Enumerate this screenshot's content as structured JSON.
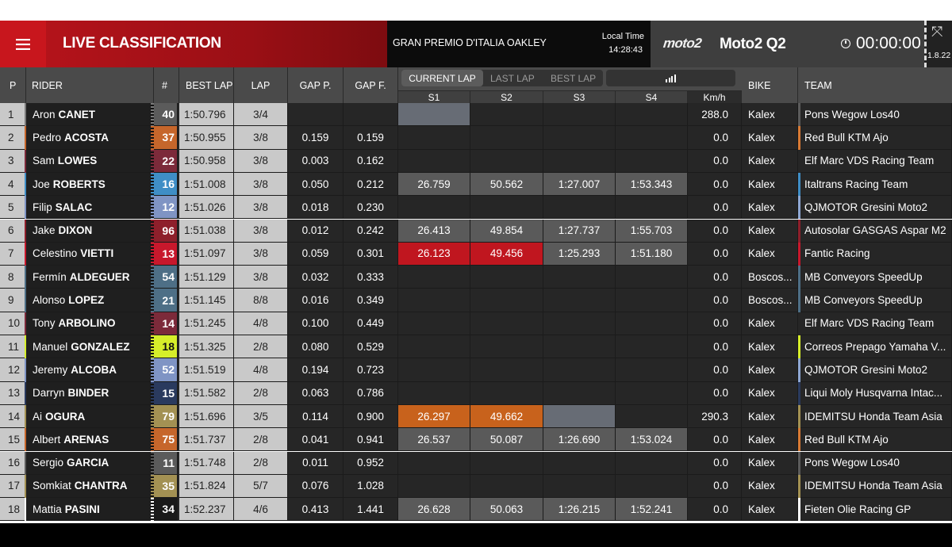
{
  "header": {
    "title": "LIVE CLASSIFICATION",
    "event": "GRAN PREMIO D'ITALIA OAKLEY",
    "local_time_label": "Local Time",
    "local_time": "14:28:43",
    "brand_logo": "moto2",
    "session": "Moto2 Q2",
    "timer": "00:00:00",
    "version": "1.8.22"
  },
  "columns": {
    "pos": "P",
    "rider": "RIDER",
    "num": "#",
    "best_lap": "BEST LAP",
    "lap": "LAP",
    "gap_p": "GAP P.",
    "gap_f": "GAP F.",
    "bike": "BIKE",
    "team": "TEAM",
    "s1": "S1",
    "s2": "S2",
    "s3": "S3",
    "s4": "S4",
    "kmh": "Km/h"
  },
  "tabs": [
    "CURRENT LAP",
    "LAST LAP",
    "BEST LAP"
  ],
  "icons": {
    "menu": "hamburger-menu-icon",
    "clock": "clock-icon",
    "expand": "expand-icon",
    "signal": "signal-bars-icon"
  },
  "colors": {
    "accent": "#c8161d"
  },
  "rows": [
    {
      "pos": "1",
      "first": "Aron",
      "last": "CANET",
      "num": "40",
      "num_bg": "#5b5b5b",
      "strip": "#7a7a7a",
      "best": "1:50.796",
      "lap": "3/4",
      "gap_p": "",
      "gap_f": "",
      "s1": "",
      "s2": "",
      "s3": "",
      "s4": "",
      "s1_bg": "#676c75",
      "kmh": "288.0",
      "bike": "Kalex",
      "team": "Pons Wegow Los40",
      "team_color": "#5b5b5b"
    },
    {
      "pos": "2",
      "first": "Pedro",
      "last": "ACOSTA",
      "num": "37",
      "num_bg": "#c6662b",
      "strip": "#c6662b",
      "best": "1:50.955",
      "lap": "3/8",
      "gap_p": "0.159",
      "gap_f": "0.159",
      "s1": "",
      "s2": "",
      "s3": "",
      "s4": "",
      "kmh": "0.0",
      "bike": "Kalex",
      "team": "Red Bull KTM Ajo",
      "team_color": "#d87a34"
    },
    {
      "pos": "3",
      "first": "Sam",
      "last": "LOWES",
      "num": "22",
      "num_bg": "#7c2a3a",
      "strip": "#7c2a3a",
      "best": "1:50.958",
      "lap": "3/8",
      "gap_p": "0.003",
      "gap_f": "0.162",
      "s1": "",
      "s2": "",
      "s3": "",
      "s4": "",
      "kmh": "0.0",
      "bike": "Kalex",
      "team": "Elf Marc VDS Racing Team",
      "team_color": "#262626"
    },
    {
      "pos": "4",
      "first": "Joe",
      "last": "ROBERTS",
      "num": "16",
      "num_bg": "#3f8ec6",
      "strip": "#3f8ec6",
      "best": "1:51.008",
      "lap": "3/8",
      "gap_p": "0.050",
      "gap_f": "0.212",
      "s1": "26.759",
      "s2": "50.562",
      "s3": "1:27.007",
      "s4": "1:53.343",
      "kmh": "0.0",
      "bike": "Kalex",
      "team": "Italtrans Racing Team",
      "team_color": "#3f8ec6"
    },
    {
      "pos": "5",
      "first": "Filip",
      "last": "SALAC",
      "num": "12",
      "num_bg": "#7f94c4",
      "strip": "#7f94c4",
      "best": "1:51.026",
      "lap": "3/8",
      "gap_p": "0.018",
      "gap_f": "0.230",
      "s1": "",
      "s2": "",
      "s3": "",
      "s4": "",
      "kmh": "0.0",
      "bike": "Kalex",
      "team": "QJMOTOR Gresini Moto2",
      "team_color": "#8fa8d4"
    },
    {
      "pos": "6",
      "first": "Jake",
      "last": "DIXON",
      "num": "96",
      "num_bg": "#8e1f2b",
      "strip": "#8e1f2b",
      "best": "1:51.038",
      "lap": "3/8",
      "gap_p": "0.012",
      "gap_f": "0.242",
      "s1": "26.413",
      "s2": "49.854",
      "s3": "1:27.737",
      "s4": "1:55.703",
      "kmh": "0.0",
      "bike": "Kalex",
      "team": "Autosolar GASGAS Aspar M2",
      "team_color": "#8e1f2b"
    },
    {
      "pos": "7",
      "first": "Celestino",
      "last": "VIETTI",
      "num": "13",
      "num_bg": "#c8182c",
      "strip": "#c8182c",
      "best": "1:51.097",
      "lap": "3/8",
      "gap_p": "0.059",
      "gap_f": "0.301",
      "s1": "26.123",
      "s2": "49.456",
      "s3": "1:25.293",
      "s4": "1:51.180",
      "s1_bg": "#c0161f",
      "s2_bg": "#c0161f",
      "kmh": "0.0",
      "bike": "Kalex",
      "team": "Fantic Racing",
      "team_color": "#c8182c"
    },
    {
      "pos": "8",
      "first": "Fermín",
      "last": "ALDEGUER",
      "num": "54",
      "num_bg": "#4e6f86",
      "strip": "#4e6f86",
      "best": "1:51.129",
      "lap": "3/8",
      "gap_p": "0.032",
      "gap_f": "0.333",
      "s1": "",
      "s2": "",
      "s3": "",
      "s4": "",
      "kmh": "0.0",
      "bike": "Boscos...",
      "team": "MB Conveyors SpeedUp",
      "team_color": "#4e6f86"
    },
    {
      "pos": "9",
      "first": "Alonso",
      "last": "LOPEZ",
      "num": "21",
      "num_bg": "#4e6f86",
      "strip": "#4e6f86",
      "best": "1:51.145",
      "lap": "8/8",
      "gap_p": "0.016",
      "gap_f": "0.349",
      "s1": "",
      "s2": "",
      "s3": "",
      "s4": "",
      "kmh": "0.0",
      "bike": "Boscos...",
      "team": "MB Conveyors SpeedUp",
      "team_color": "#4e6f86"
    },
    {
      "pos": "10",
      "first": "Tony",
      "last": "ARBOLINO",
      "num": "14",
      "num_bg": "#7c2a3a",
      "strip": "#7c2a3a",
      "best": "1:51.245",
      "lap": "4/8",
      "gap_p": "0.100",
      "gap_f": "0.449",
      "s1": "",
      "s2": "",
      "s3": "",
      "s4": "",
      "kmh": "0.0",
      "bike": "Kalex",
      "team": "Elf Marc VDS Racing Team",
      "team_color": "#262626"
    },
    {
      "pos": "11",
      "first": "Manuel",
      "last": "GONZALEZ",
      "num": "18",
      "num_bg": "#d6ee2a",
      "num_color": "#111",
      "strip": "#d6ee2a",
      "best": "1:51.325",
      "lap": "2/8",
      "gap_p": "0.080",
      "gap_f": "0.529",
      "s1": "",
      "s2": "",
      "s3": "",
      "s4": "",
      "kmh": "0.0",
      "bike": "Kalex",
      "team": "Correos Prepago Yamaha V...",
      "team_color": "#d6ee2a"
    },
    {
      "pos": "12",
      "first": "Jeremy",
      "last": "ALCOBA",
      "num": "52",
      "num_bg": "#7f94c4",
      "strip": "#7f94c4",
      "best": "1:51.519",
      "lap": "4/8",
      "gap_p": "0.194",
      "gap_f": "0.723",
      "s1": "",
      "s2": "",
      "s3": "",
      "s4": "",
      "kmh": "0.0",
      "bike": "Kalex",
      "team": "QJMOTOR Gresini Moto2",
      "team_color": "#8fa8d4"
    },
    {
      "pos": "13",
      "first": "Darryn",
      "last": "BINDER",
      "num": "15",
      "num_bg": "#2a3a5e",
      "strip": "#2a3a5e",
      "best": "1:51.582",
      "lap": "2/8",
      "gap_p": "0.063",
      "gap_f": "0.786",
      "s1": "",
      "s2": "",
      "s3": "",
      "s4": "",
      "kmh": "0.0",
      "bike": "Kalex",
      "team": "Liqui Moly Husqvarna Intac...",
      "team_color": "#2a3a5e"
    },
    {
      "pos": "14",
      "first": "Ai",
      "last": "OGURA",
      "num": "79",
      "num_bg": "#a39153",
      "strip": "#a39153",
      "best": "1:51.696",
      "lap": "3/5",
      "gap_p": "0.114",
      "gap_f": "0.900",
      "s1": "26.297",
      "s2": "49.662",
      "s3": "",
      "s4": "",
      "s1_bg": "#c8621c",
      "s2_bg": "#c8621c",
      "s3_bg": "#676c75",
      "kmh": "290.3",
      "bike": "Kalex",
      "team": "IDEMITSU Honda Team Asia",
      "team_color": "#a39153"
    },
    {
      "pos": "15",
      "first": "Albert",
      "last": "ARENAS",
      "num": "75",
      "num_bg": "#c6662b",
      "strip": "#c6662b",
      "best": "1:51.737",
      "lap": "2/8",
      "gap_p": "0.041",
      "gap_f": "0.941",
      "s1": "26.537",
      "s2": "50.087",
      "s3": "1:26.690",
      "s4": "1:53.024",
      "kmh": "0.0",
      "bike": "Kalex",
      "team": "Red Bull KTM Ajo",
      "team_color": "#d87a34"
    },
    {
      "pos": "16",
      "first": "Sergio",
      "last": "GARCIA",
      "num": "11",
      "num_bg": "#5b5b5b",
      "strip": "#5b5b5b",
      "best": "1:51.748",
      "lap": "2/8",
      "gap_p": "0.011",
      "gap_f": "0.952",
      "s1": "",
      "s2": "",
      "s3": "",
      "s4": "",
      "kmh": "0.0",
      "bike": "Kalex",
      "team": "Pons Wegow Los40",
      "team_color": "#5b5b5b"
    },
    {
      "pos": "17",
      "first": "Somkiat",
      "last": "CHANTRA",
      "num": "35",
      "num_bg": "#a39153",
      "strip": "#a39153",
      "best": "1:51.824",
      "lap": "5/7",
      "gap_p": "0.076",
      "gap_f": "1.028",
      "s1": "",
      "s2": "",
      "s3": "",
      "s4": "",
      "kmh": "0.0",
      "bike": "Kalex",
      "team": "IDEMITSU Honda Team Asia",
      "team_color": "#a39153"
    },
    {
      "pos": "18",
      "first": "Mattia",
      "last": "PASINI",
      "num": "34",
      "num_bg": "#1a1a1a",
      "strip": "#ffffff",
      "best": "1:52.237",
      "lap": "4/6",
      "gap_p": "0.413",
      "gap_f": "1.441",
      "s1": "26.628",
      "s2": "50.063",
      "s3": "1:26.215",
      "s4": "1:52.241",
      "kmh": "0.0",
      "bike": "Kalex",
      "team": "Fieten Olie Racing GP",
      "team_color": "#ffffff"
    }
  ]
}
